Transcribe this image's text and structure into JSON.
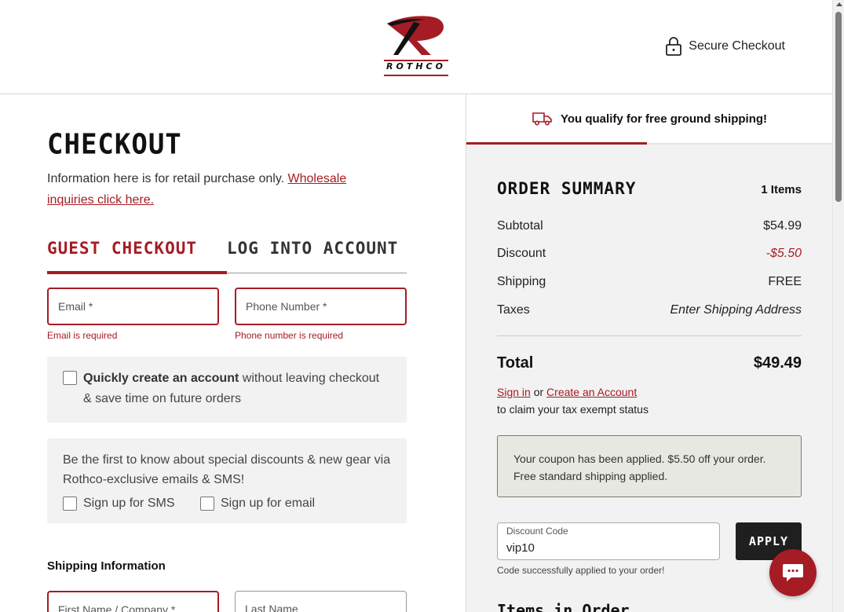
{
  "brand": {
    "logo_text": "ROTHCO",
    "colors": {
      "primary": "#a51c24",
      "dark": "#1f1f1f",
      "panel": "#f2f2f2"
    }
  },
  "header": {
    "secure_label": "Secure Checkout",
    "secure_icon": "lock-icon"
  },
  "checkout": {
    "title": "CHECKOUT",
    "retail_notice": "Information here is for retail purchase only.",
    "wholesale_link": "Wholesale inquiries click here.",
    "tabs": [
      {
        "label": "GUEST CHECKOUT",
        "active": true
      },
      {
        "label": "LOG INTO ACCOUNT",
        "active": false
      }
    ],
    "email": {
      "placeholder": "Email *",
      "error": "Email is required"
    },
    "phone": {
      "placeholder": "Phone Number *",
      "error": "Phone number is required"
    },
    "account_option": {
      "bold": "Quickly create an account",
      "rest": "without leaving checkout & save time on future orders",
      "checked": false
    },
    "promo": {
      "text": "Be the first to know about special discounts & new gear via Rothco-exclusive emails & SMS!",
      "sms_label": "Sign up for SMS",
      "email_label": "Sign up for email"
    },
    "shipping": {
      "heading": "Shipping Information",
      "first_name_placeholder": "First Name / Company *",
      "last_name_placeholder": "Last Name"
    }
  },
  "summary": {
    "free_shipping": "You qualify for free ground shipping!",
    "title": "ORDER SUMMARY",
    "items_count": "1 Items",
    "rows": [
      {
        "label": "Subtotal",
        "value": "$54.99"
      },
      {
        "label": "Discount",
        "value": "-$5.50"
      },
      {
        "label": "Shipping",
        "value": "FREE"
      },
      {
        "label": "Taxes",
        "value": "Enter Shipping Address"
      }
    ],
    "total_label": "Total",
    "total_value": "$49.49",
    "sign_in": "Sign in",
    "or": "or",
    "create_account": "Create an Account",
    "tax_exempt": "to claim your tax exempt status",
    "coupon_message": "Your coupon has been applied. $5.50 off your order. Free standard shipping applied.",
    "discount_code_label": "Discount Code",
    "discount_code_value": "vip10",
    "apply_label": "APPLY",
    "code_message": "Code successfully applied to your order!",
    "items_heading": "Items in Order"
  },
  "chat": {
    "icon": "chat-icon"
  }
}
